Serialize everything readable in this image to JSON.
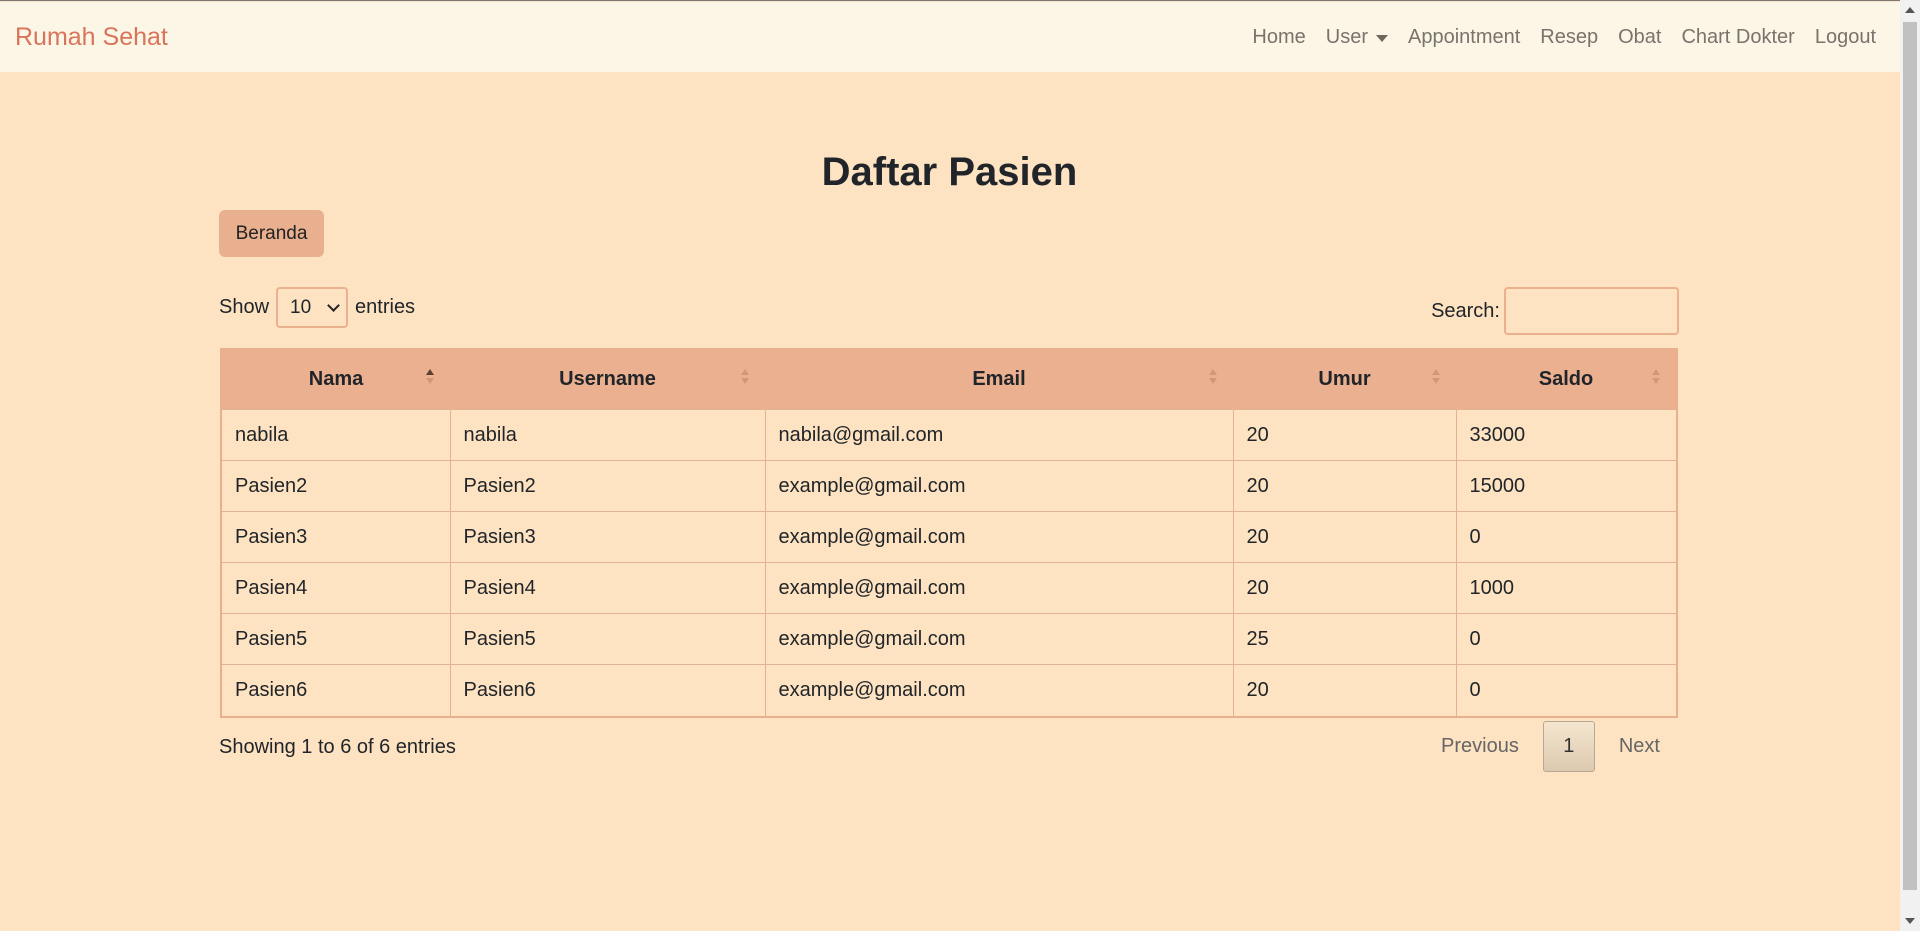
{
  "navbar": {
    "brand": "Rumah Sehat",
    "links": [
      "Home",
      "User",
      "Appointment",
      "Resep",
      "Obat",
      "Chart Dokter",
      "Logout"
    ]
  },
  "page": {
    "title": "Daftar Pasien",
    "beranda_button": "Beranda"
  },
  "length": {
    "show_label": "Show",
    "selected": "10",
    "entries_label": "entries"
  },
  "search": {
    "label": "Search:",
    "value": ""
  },
  "table": {
    "columns": [
      "Nama",
      "Username",
      "Email",
      "Umur",
      "Saldo"
    ],
    "rows": [
      [
        "nabila",
        "nabila",
        "nabila@gmail.com",
        "20",
        "33000"
      ],
      [
        "Pasien2",
        "Pasien2",
        "example@gmail.com",
        "20",
        "15000"
      ],
      [
        "Pasien3",
        "Pasien3",
        "example@gmail.com",
        "20",
        "0"
      ],
      [
        "Pasien4",
        "Pasien4",
        "example@gmail.com",
        "20",
        "1000"
      ],
      [
        "Pasien5",
        "Pasien5",
        "example@gmail.com",
        "25",
        "0"
      ],
      [
        "Pasien6",
        "Pasien6",
        "example@gmail.com",
        "20",
        "0"
      ]
    ]
  },
  "footer": {
    "info": "Showing 1 to 6 of 6 entries",
    "previous": "Previous",
    "current_page": "1",
    "next": "Next"
  },
  "colors": {
    "background": "#fde3c2",
    "navbar": "#fbf6e6",
    "brand": "#d9745b",
    "accent": "#ebb08f"
  }
}
